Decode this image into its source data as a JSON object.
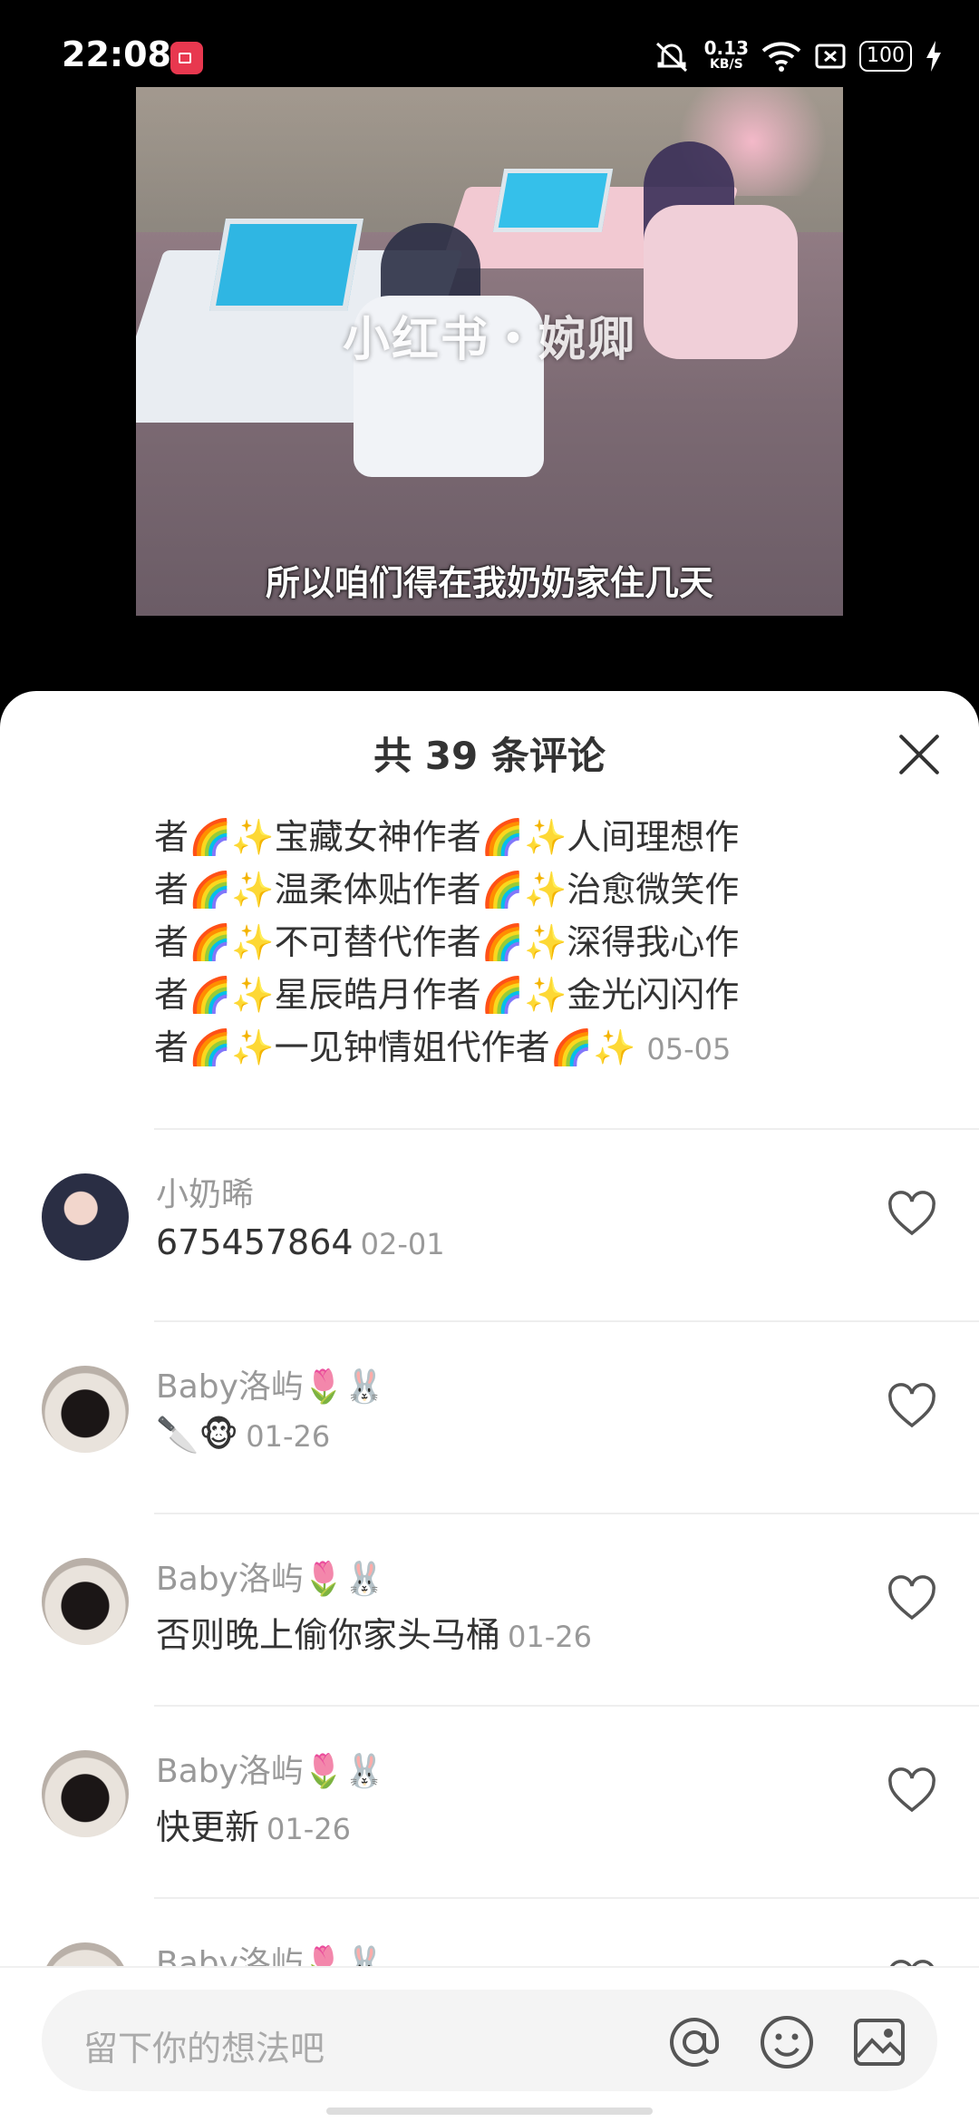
{
  "status_bar": {
    "time": "22:08",
    "net_speed": "0.13",
    "net_unit": "KB/S",
    "battery": "100"
  },
  "video": {
    "watermark": "小红书・婉卿",
    "subtitle": "所以咱们得在我奶奶家住几天"
  },
  "comments_header": {
    "title": "共 39 条评论"
  },
  "continued_comment": {
    "lines": [
      "者🌈✨宝藏女神作者🌈✨人间理想作",
      "者🌈✨温柔体贴作者🌈✨治愈微笑作",
      "者🌈✨不可替代作者🌈✨深得我心作",
      "者🌈✨星辰皓月作者🌈✨金光闪闪作",
      "者🌈✨一见钟情姐代作者🌈✨"
    ],
    "date": "05-05"
  },
  "comments": [
    {
      "name": "小奶晞",
      "text": "675457864",
      "date": "02-01"
    },
    {
      "name": "Baby洛屿🌷🐰",
      "text": "🔪🐵",
      "date": "01-26"
    },
    {
      "name": "Baby洛屿🌷🐰",
      "text": "否则晚上偷你家头马桶",
      "date": "01-26"
    },
    {
      "name": "Baby洛屿🌷🐰",
      "text": "快更新",
      "date": "01-26"
    },
    {
      "name": "Baby洛屿🌷🐰",
      "text": "",
      "date": ""
    }
  ],
  "input_bar": {
    "placeholder": "留下你的想法吧"
  },
  "icons": {
    "close": "close-icon",
    "like": "heart-outline-icon",
    "mention": "at-sign-icon",
    "emoji": "smiley-icon",
    "image": "image-icon"
  }
}
